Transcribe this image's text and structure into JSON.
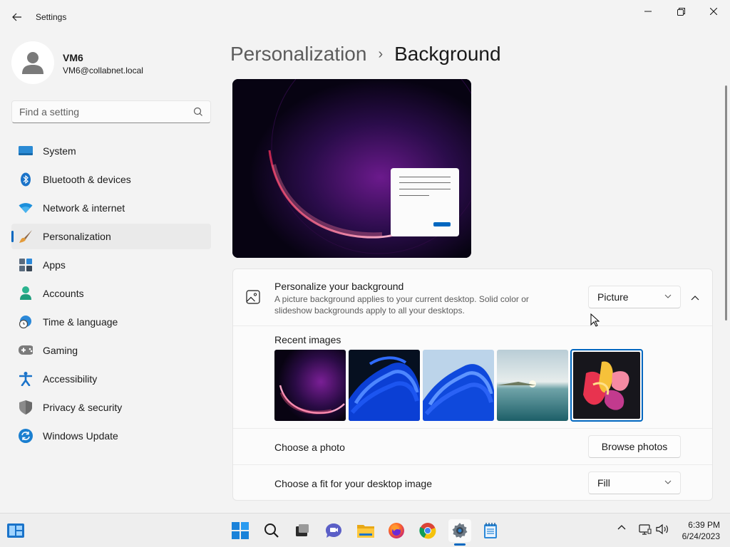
{
  "window": {
    "title": "Settings",
    "minimize_icon": "minimize-icon",
    "maximize_icon": "restore-icon",
    "close_icon": "close-icon"
  },
  "user": {
    "name": "VM6",
    "email": "VM6@collabnet.local"
  },
  "search": {
    "placeholder": "Find a setting",
    "value": ""
  },
  "sidebar": {
    "items": [
      {
        "label": "System",
        "icon": "system-icon",
        "active": false
      },
      {
        "label": "Bluetooth & devices",
        "icon": "bluetooth-icon",
        "active": false
      },
      {
        "label": "Network & internet",
        "icon": "wifi-icon",
        "active": false
      },
      {
        "label": "Personalization",
        "icon": "brush-icon",
        "active": true
      },
      {
        "label": "Apps",
        "icon": "apps-icon",
        "active": false
      },
      {
        "label": "Accounts",
        "icon": "accounts-icon",
        "active": false
      },
      {
        "label": "Time & language",
        "icon": "globe-clock-icon",
        "active": false
      },
      {
        "label": "Gaming",
        "icon": "gamepad-icon",
        "active": false
      },
      {
        "label": "Accessibility",
        "icon": "accessibility-icon",
        "active": false
      },
      {
        "label": "Privacy & security",
        "icon": "shield-icon",
        "active": false
      },
      {
        "label": "Windows Update",
        "icon": "update-icon",
        "active": false
      }
    ]
  },
  "breadcrumb": {
    "parent": "Personalization",
    "separator": "›",
    "current": "Background"
  },
  "background_panel": {
    "title": "Personalize your background",
    "description": "A picture background applies to your current desktop. Solid color or slideshow backgrounds apply to all your desktops.",
    "type_value": "Picture",
    "recent_images_label": "Recent images",
    "recent_images": [
      "bloom-dark-purple",
      "bloom-blue-dark",
      "bloom-blue-light",
      "lake-landscape",
      "colorful-flower"
    ],
    "selected_image_index": 4,
    "choose_photo_label": "Choose a photo",
    "browse_button": "Browse photos",
    "fit_label": "Choose a fit for your desktop image",
    "fit_value": "Fill"
  },
  "taskbar": {
    "apps": [
      "start-icon",
      "search-icon",
      "task-view-icon",
      "chat-icon",
      "file-explorer-icon",
      "firefox-icon",
      "chrome-icon",
      "settings-icon",
      "notepad-icon"
    ],
    "active_app": "settings-icon",
    "time": "6:39 PM",
    "date": "6/24/2023"
  },
  "colors": {
    "accent": "#0067c0",
    "background": "#f3f3f3",
    "card": "#fbfbfb"
  }
}
